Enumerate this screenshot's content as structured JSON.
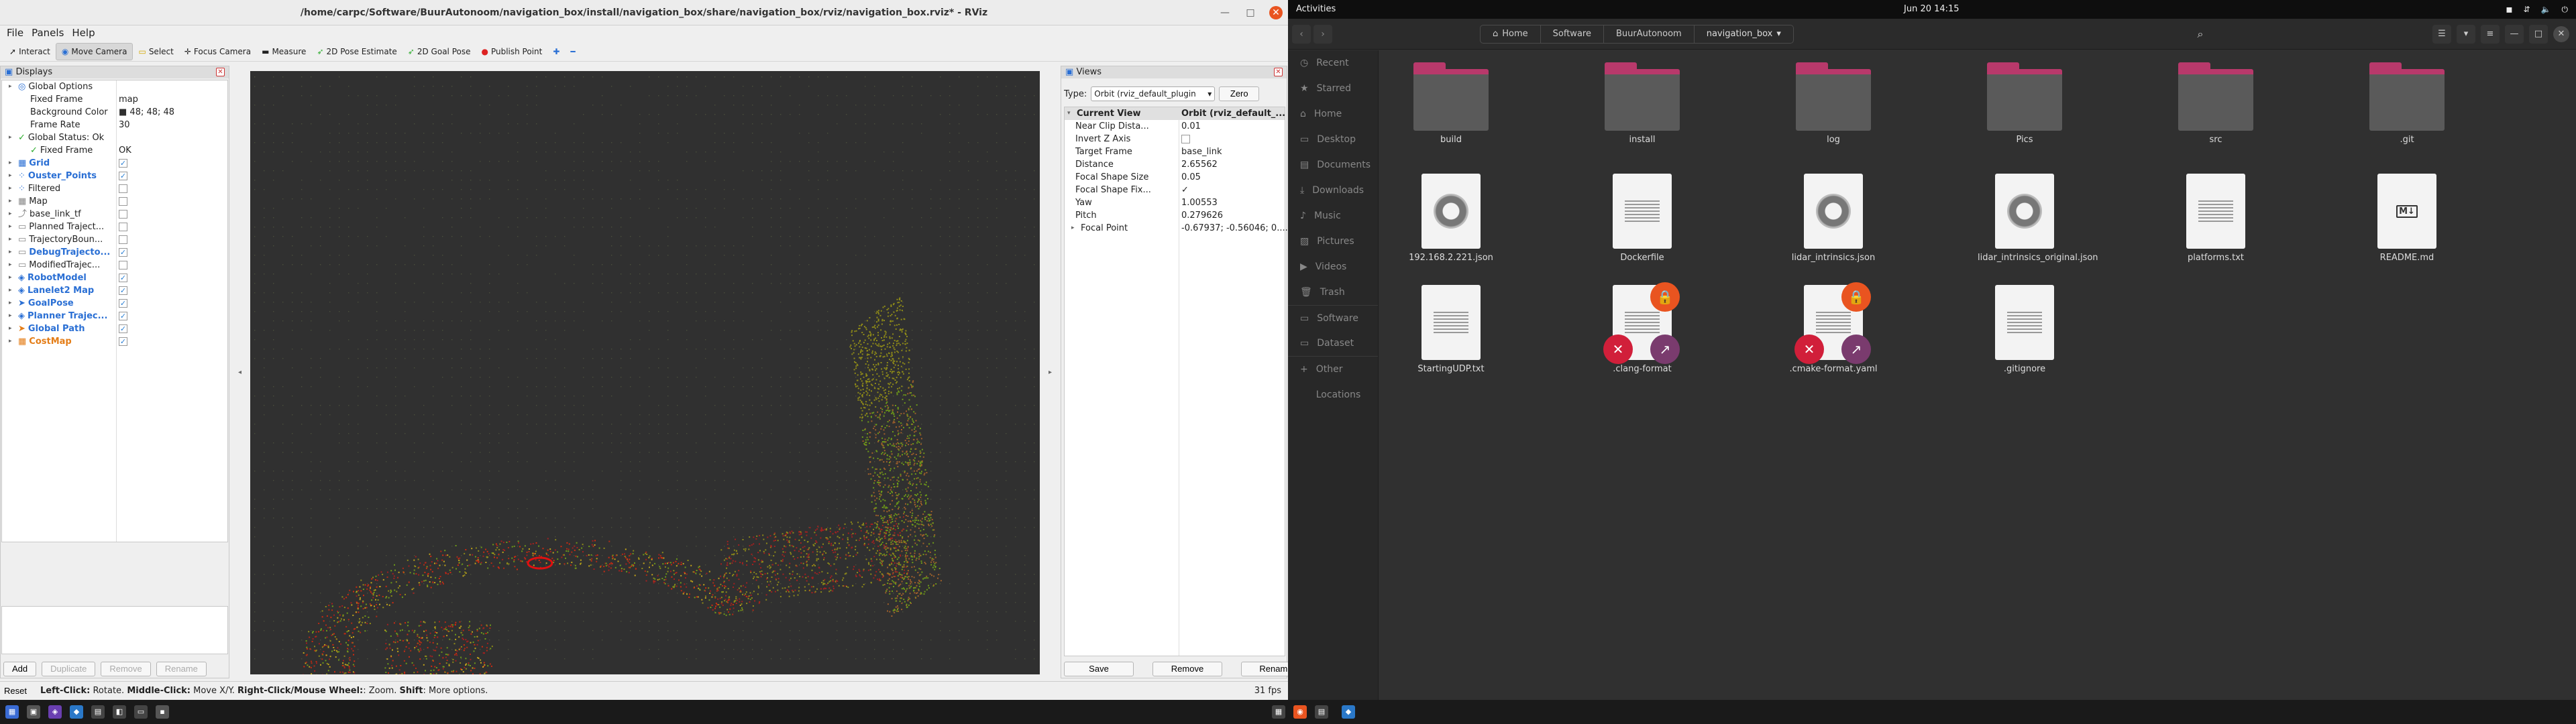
{
  "rviz": {
    "title": "/home/carpc/Software/BuurAutonoom/navigation_box/install/navigation_box/share/navigation_box/rviz/navigation_box.rviz* - RViz",
    "menu": [
      "File",
      "Panels",
      "Help"
    ],
    "tools": [
      {
        "label": "Interact",
        "icon": "cursor-icon"
      },
      {
        "label": "Move Camera",
        "icon": "move-camera-icon"
      },
      {
        "label": "Select",
        "icon": "select-icon"
      },
      {
        "label": "Focus Camera",
        "icon": "focus-icon"
      },
      {
        "label": "Measure",
        "icon": "ruler-icon"
      },
      {
        "label": "2D Pose Estimate",
        "icon": "green-arrow-icon"
      },
      {
        "label": "2D Goal Pose",
        "icon": "green-arrow-icon"
      },
      {
        "label": "Publish Point",
        "icon": "pin-icon"
      }
    ],
    "displays": {
      "title": "Displays",
      "rows": [
        {
          "label": "Global Options",
          "value": ""
        },
        {
          "label": "Fixed Frame",
          "value": "map"
        },
        {
          "label": "Background Color",
          "value": "48; 48; 48"
        },
        {
          "label": "Frame Rate",
          "value": "30"
        },
        {
          "label": "Global Status: Ok",
          "value": ""
        },
        {
          "label": "Fixed Frame",
          "value": "OK"
        },
        {
          "label": "Grid",
          "checked": true
        },
        {
          "label": "Ouster_Points",
          "checked": true
        },
        {
          "label": "Filtered",
          "checked": false
        },
        {
          "label": "Map",
          "checked": false
        },
        {
          "label": "base_link_tf",
          "checked": false
        },
        {
          "label": "Planned Traject...",
          "checked": false
        },
        {
          "label": "TrajectoryBoun...",
          "checked": false
        },
        {
          "label": "DebugTrajecto...",
          "checked": true
        },
        {
          "label": "ModifiedTrajec...",
          "checked": false
        },
        {
          "label": "RobotModel",
          "checked": true
        },
        {
          "label": "Lanelet2 Map",
          "checked": true
        },
        {
          "label": "GoalPose",
          "checked": true
        },
        {
          "label": "Planner Trajec...",
          "checked": true
        },
        {
          "label": "Global Path",
          "checked": true
        },
        {
          "label": "CostMap",
          "checked": true
        }
      ],
      "buttons": [
        "Add",
        "Duplicate",
        "Remove",
        "Rename"
      ]
    },
    "views": {
      "title": "Views",
      "type_label": "Type:",
      "type_value": "Orbit (rviz_default_plugin",
      "zero": "Zero",
      "rows": [
        {
          "label": "Current View",
          "value": "Orbit (rviz_default_..."
        },
        {
          "label": "Near Clip Dista...",
          "value": "0.01"
        },
        {
          "label": "Invert Z Axis",
          "value": ""
        },
        {
          "label": "Target Frame",
          "value": "base_link"
        },
        {
          "label": "Distance",
          "value": "2.65562"
        },
        {
          "label": "Focal Shape Size",
          "value": "0.05"
        },
        {
          "label": "Focal Shape Fix...",
          "value": "✓"
        },
        {
          "label": "Yaw",
          "value": "1.00553"
        },
        {
          "label": "Pitch",
          "value": "0.279626"
        },
        {
          "label": "Focal Point",
          "value": "-0.67937; -0.56046; 0...."
        }
      ],
      "buttons": [
        "Save",
        "Remove",
        "Rename"
      ]
    },
    "status": {
      "reset": "Reset",
      "hint_parts": [
        "Left-Click:",
        " Rotate. ",
        "Middle-Click:",
        " Move X/Y. ",
        "Right-Click/Mouse Wheel:",
        ": Zoom. ",
        "Shift",
        ": More options."
      ],
      "fps": "31 fps"
    }
  },
  "gnome": {
    "activities": "Activities",
    "clock": "Jun 20  14:15"
  },
  "files": {
    "breadcrumbs": [
      "Home",
      "Software",
      "BuurAutonoom",
      "navigation_box"
    ],
    "sidebar": [
      {
        "label": "Recent",
        "icon": "clock-icon"
      },
      {
        "label": "Starred",
        "icon": "star-icon"
      },
      {
        "label": "Home",
        "icon": "home-icon"
      },
      {
        "label": "Desktop",
        "icon": "desktop-icon"
      },
      {
        "label": "Documents",
        "icon": "document-icon"
      },
      {
        "label": "Downloads",
        "icon": "download-icon"
      },
      {
        "label": "Music",
        "icon": "music-icon"
      },
      {
        "label": "Pictures",
        "icon": "picture-icon"
      },
      {
        "label": "Videos",
        "icon": "video-icon"
      },
      {
        "label": "Trash",
        "icon": "trash-icon"
      },
      {
        "label": "Software",
        "icon": "drive-icon"
      },
      {
        "label": "Dataset",
        "icon": "drive-icon"
      },
      {
        "label": "Other Locations",
        "icon": "plus-icon"
      }
    ],
    "items": [
      {
        "name": "build",
        "kind": "folder"
      },
      {
        "name": "install",
        "kind": "folder"
      },
      {
        "name": "log",
        "kind": "folder"
      },
      {
        "name": "Pics",
        "kind": "folder"
      },
      {
        "name": "src",
        "kind": "folder"
      },
      {
        "name": ".git",
        "kind": "folder"
      },
      {
        "name": "192.168.2.221.json",
        "kind": "json"
      },
      {
        "name": "Dockerfile",
        "kind": "text"
      },
      {
        "name": "lidar_intrinsics.json",
        "kind": "json"
      },
      {
        "name": "lidar_intrinsics_original.json",
        "kind": "json"
      },
      {
        "name": "platforms.txt",
        "kind": "text"
      },
      {
        "name": "README.md",
        "kind": "markdown"
      },
      {
        "name": "StartingUDP.txt",
        "kind": "text"
      },
      {
        "name": ".clang-format",
        "kind": "locked-link"
      },
      {
        "name": ".cmake-format.yaml",
        "kind": "locked-link"
      },
      {
        "name": ".gitignore",
        "kind": "text"
      }
    ]
  }
}
